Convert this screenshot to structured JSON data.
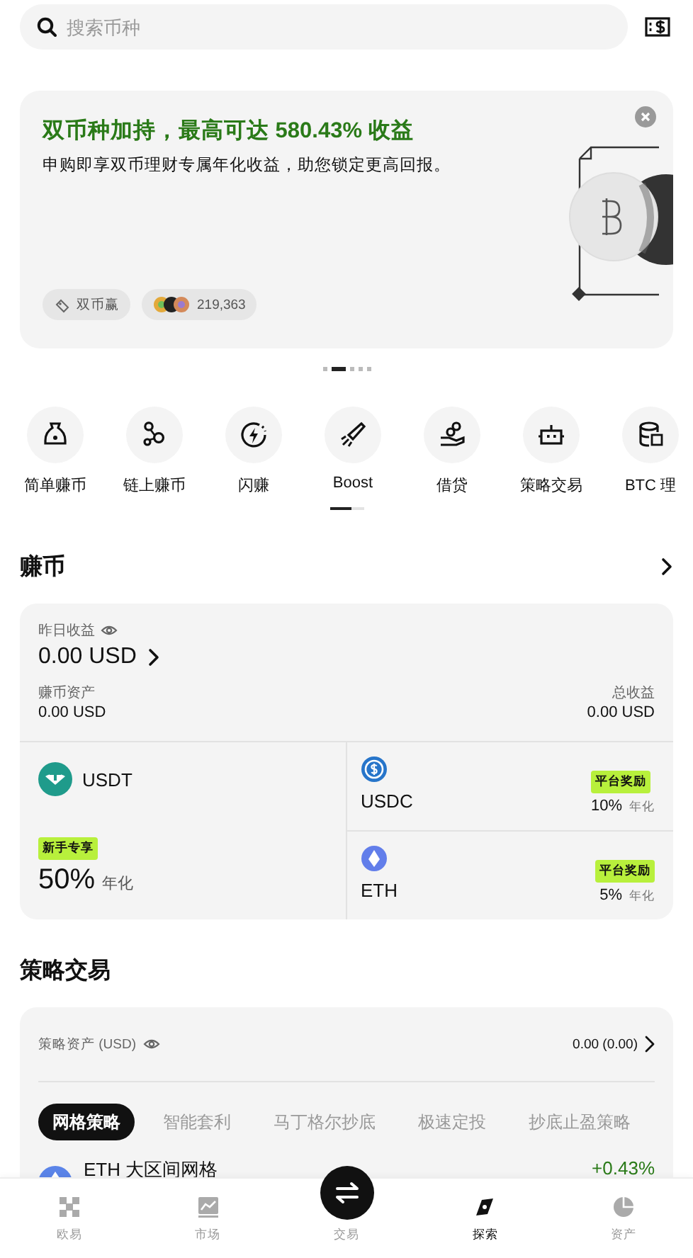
{
  "search": {
    "placeholder": "搜索币种"
  },
  "banner": {
    "title": "双币种加持，最高可达 580.43% 收益",
    "subtitle": "申购即享双币理财专属年化收益，助您锁定更高回报。",
    "tag": "双币赢",
    "participants": "219,363"
  },
  "carousel_dots": [
    {
      "selected": false
    },
    {
      "selected": true
    },
    {
      "selected": false
    },
    {
      "selected": false
    },
    {
      "selected": false
    }
  ],
  "shortcuts": [
    {
      "label": "简单赚币"
    },
    {
      "label": "链上赚币"
    },
    {
      "label": "闪赚"
    },
    {
      "label": "Boost"
    },
    {
      "label": "借贷"
    },
    {
      "label": "策略交易"
    },
    {
      "label": "BTC 理"
    }
  ],
  "earn": {
    "title": "赚币",
    "yesterday_label": "昨日收益",
    "yesterday_value": "0.00 USD",
    "assets_label": "赚币资产",
    "assets_value": "0.00 USD",
    "total_label": "总收益",
    "total_value": "0.00 USD",
    "featured": {
      "coin": "USDT",
      "badge": "新手专享",
      "rate": "50%",
      "rate_unit": "年化"
    },
    "products": [
      {
        "coin": "USDC",
        "badge": "平台奖励",
        "rate": "10%",
        "rate_unit": "年化"
      },
      {
        "coin": "ETH",
        "badge": "平台奖励",
        "rate": "5%",
        "rate_unit": "年化"
      }
    ]
  },
  "strategy": {
    "title": "策略交易",
    "assets_label": "策略资产 (USD)",
    "assets_value": "0.00 (0.00)",
    "tabs": [
      {
        "label": "网格策略",
        "selected": true
      },
      {
        "label": "智能套利",
        "selected": false
      },
      {
        "label": "马丁格尔抄底",
        "selected": false
      },
      {
        "label": "极速定投",
        "selected": false
      },
      {
        "label": "抄底止盈策略",
        "selected": false
      }
    ],
    "items": [
      {
        "name": "ETH 大区间网格",
        "change": "+0.43%"
      }
    ]
  },
  "nav": [
    {
      "label": "欧易",
      "selected": false
    },
    {
      "label": "市场",
      "selected": false
    },
    {
      "label": "交易",
      "selected": false
    },
    {
      "label": "探索",
      "selected": true
    },
    {
      "label": "资产",
      "selected": false
    }
  ]
}
